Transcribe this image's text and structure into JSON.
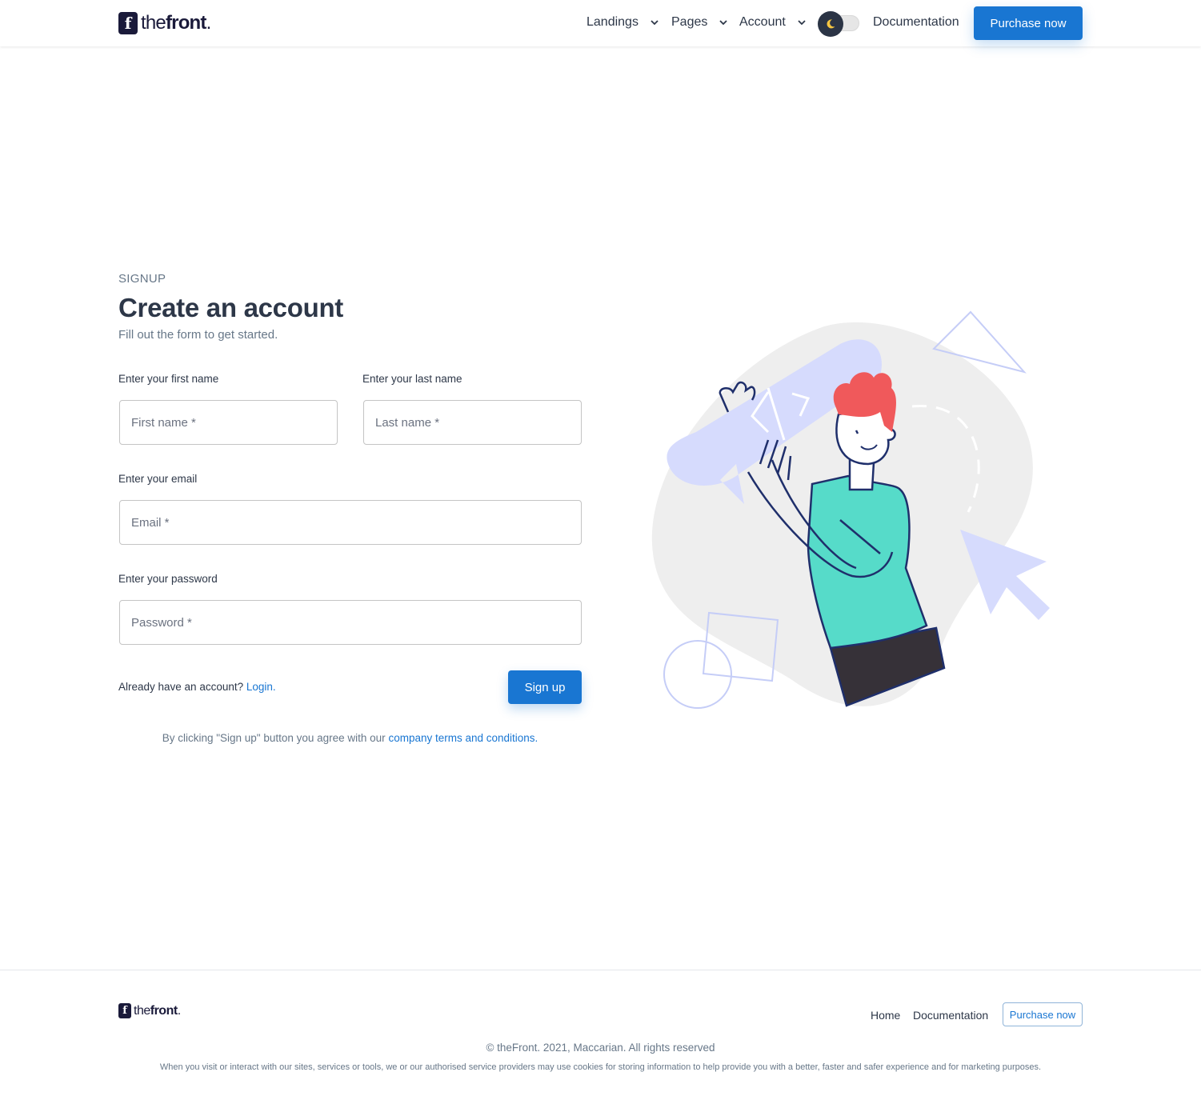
{
  "brand": {
    "mark": "f",
    "name_light": "the",
    "name_bold": "front",
    "name_dot": "."
  },
  "header": {
    "nav": [
      {
        "label": "Landings"
      },
      {
        "label": "Pages"
      },
      {
        "label": "Account"
      }
    ],
    "theme_toggle": {
      "mode": "dark",
      "icon": "moon-icon"
    },
    "documentation_label": "Documentation",
    "purchase_label": "Purchase now"
  },
  "signup": {
    "overline": "SIGNUP",
    "title": "Create an account",
    "subtitle": "Fill out the form to get started.",
    "fields": {
      "first_name": {
        "label": "Enter your first name",
        "placeholder": "First name *",
        "value": ""
      },
      "last_name": {
        "label": "Enter your last name",
        "placeholder": "Last name *",
        "value": ""
      },
      "email": {
        "label": "Enter your email",
        "placeholder": "Email *",
        "value": ""
      },
      "password": {
        "label": "Enter your password",
        "placeholder": "Password *",
        "value": ""
      }
    },
    "already_text": "Already have an account?",
    "login_link": "Login.",
    "submit_label": "Sign up",
    "terms_text": "By clicking \"Sign up\" button you agree with our",
    "terms_link": "company terms and conditions."
  },
  "footer": {
    "links": [
      {
        "label": "Home"
      },
      {
        "label": "Documentation"
      }
    ],
    "purchase_label": "Purchase now",
    "copyright": "© theFront. 2021, Maccarian. All rights reserved",
    "cookie_notice": "When you visit or interact with our sites, services or tools, we or our authorised service providers may use cookies for storing information to help provide you with a better, faster and safer experience and for marketing purposes."
  },
  "colors": {
    "primary": "#1976d2",
    "text_dark": "#2d3748",
    "text_muted": "#677788",
    "illustration_blob": "#eeeeee",
    "illustration_accent": "#d6dbfd",
    "shirt": "#56dbc9",
    "hair": "#f0595b"
  }
}
